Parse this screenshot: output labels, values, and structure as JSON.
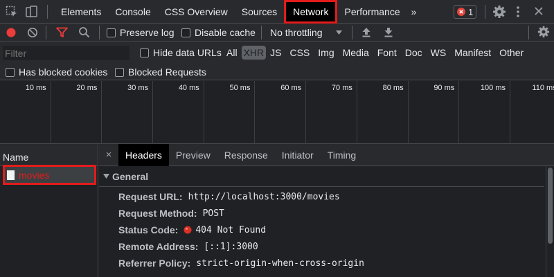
{
  "tabs": {
    "elements": "Elements",
    "console": "Console",
    "css_overview": "CSS Overview",
    "sources": "Sources",
    "network": "Network",
    "performance": "Performance",
    "more": "»",
    "error_count": "1"
  },
  "toolbar": {
    "preserve_log": "Preserve log",
    "disable_cache": "Disable cache",
    "throttling": "No throttling"
  },
  "filter": {
    "placeholder": "Filter",
    "hide_data_urls": "Hide data URLs",
    "types": [
      "All",
      "XHR",
      "JS",
      "CSS",
      "Img",
      "Media",
      "Font",
      "Doc",
      "WS",
      "Manifest",
      "Other"
    ],
    "selected_type": "XHR",
    "has_blocked_cookies": "Has blocked cookies",
    "blocked_requests": "Blocked Requests"
  },
  "timeline": {
    "ticks": [
      "10 ms",
      "20 ms",
      "30 ms",
      "40 ms",
      "50 ms",
      "60 ms",
      "70 ms",
      "80 ms",
      "90 ms",
      "100 ms",
      "110 ms"
    ]
  },
  "requests": {
    "column_name": "Name",
    "items": [
      {
        "name": "movies"
      }
    ]
  },
  "details": {
    "close": "×",
    "tabs": [
      "Headers",
      "Preview",
      "Response",
      "Initiator",
      "Timing"
    ],
    "section_title": "General",
    "request_url_key": "Request URL:",
    "request_url": "http://localhost:3000/movies",
    "request_method_key": "Request Method:",
    "request_method": "POST",
    "status_code_key": "Status Code:",
    "status_code": "404 Not Found",
    "remote_address_key": "Remote Address:",
    "remote_address": "[::1]:3000",
    "referrer_policy_key": "Referrer Policy:",
    "referrer_policy": "strict-origin-when-cross-origin"
  },
  "colors": {
    "highlight": "#e31b1b",
    "record": "#ee3b3b",
    "error_status": "#d93025"
  }
}
